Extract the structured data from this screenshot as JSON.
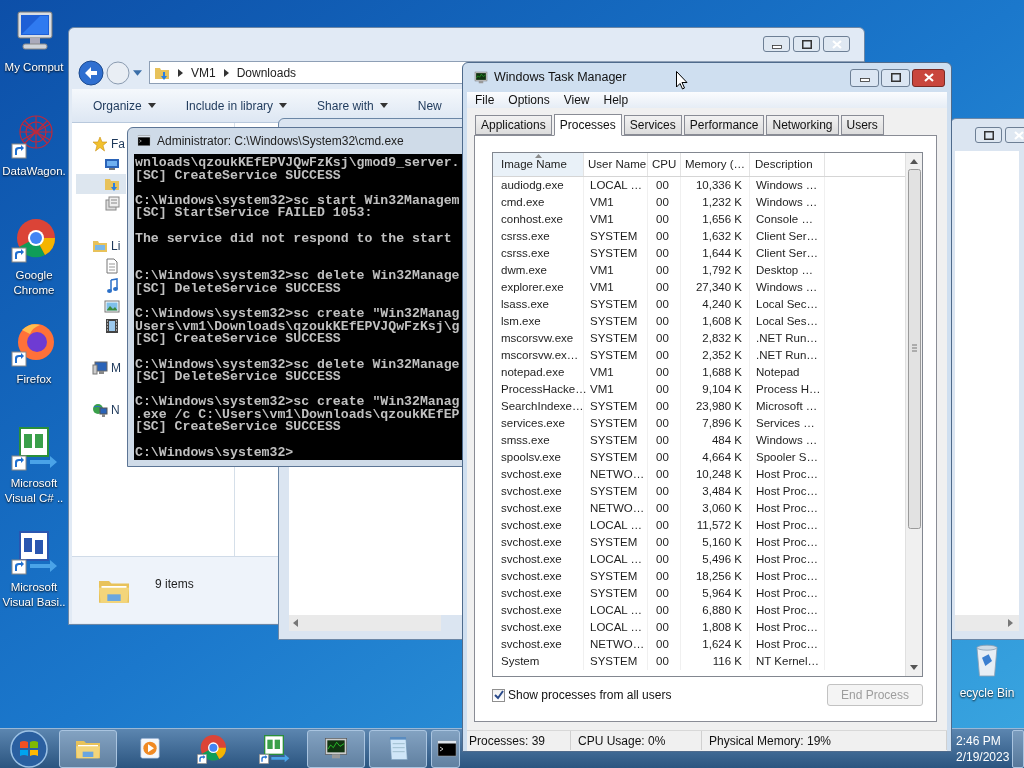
{
  "desktop_icons": [
    {
      "label": "My Comput",
      "kind": "computer"
    },
    {
      "label": "DataWagon.",
      "kind": "datawagon"
    },
    {
      "label": "Google Chrome",
      "kind": "chrome"
    },
    {
      "label": "Firefox",
      "kind": "firefox"
    },
    {
      "label": "Microsoft Visual C# ..",
      "kind": "csharp"
    },
    {
      "label": "Microsoft Visual Basi..",
      "kind": "vb"
    }
  ],
  "recycle_bin": {
    "label": "ecycle Bin"
  },
  "explorer": {
    "breadcrumb": [
      "VM1",
      "Downloads"
    ],
    "toolbar": [
      {
        "label": "Organize",
        "dropdown": true
      },
      {
        "label": "Include in library",
        "dropdown": true
      },
      {
        "label": "Share with",
        "dropdown": true
      },
      {
        "label": "New",
        "dropdown": false
      }
    ],
    "nav": [
      {
        "label": "Fa",
        "kind": "favorites",
        "selected": false,
        "children": [
          {
            "kind": "desktop",
            "selected": false
          },
          {
            "kind": "downloads",
            "selected": true
          },
          {
            "kind": "recent",
            "selected": false
          }
        ]
      },
      {
        "label": "Li",
        "kind": "libraries",
        "selected": false,
        "children": [
          {
            "kind": "documents",
            "selected": false
          },
          {
            "kind": "music",
            "selected": false
          },
          {
            "kind": "pictures",
            "selected": false
          },
          {
            "kind": "videos",
            "selected": false
          }
        ]
      },
      {
        "label": "M",
        "kind": "computer",
        "selected": false
      },
      {
        "label": "N",
        "kind": "network",
        "selected": false
      }
    ],
    "status": "9 items"
  },
  "cmd": {
    "title": "Administrator: C:\\Windows\\System32\\cmd.exe",
    "output": "wnloads\\qzoukKEfEPVJQwFzKsj\\gmod9_server.\n[SC] CreateService SUCCESS\n\nC:\\Windows\\system32>sc start Win32Managem\n[SC] StartService FAILED 1053:\n\nThe service did not respond to the start\n\n\nC:\\Windows\\system32>sc delete Win32Manage\n[SC] DeleteService SUCCESS\n\nC:\\Windows\\system32>sc create \"Win32Manag\nUsers\\vm1\\Downloads\\qzoukKEfEPVJQwFzKsj\\g\n[SC] CreateService SUCCESS\n\nC:\\Windows\\system32>sc delete Win32Manage\n[SC] DeleteService SUCCESS\n\nC:\\Windows\\system32>sc create \"Win32Manag\n.exe /c C:\\Users\\vm1\\Downloads\\qzoukKEfEP\n[SC] CreateService SUCCESS\n\nC:\\Windows\\system32>"
  },
  "task_manager": {
    "title": "Windows Task Manager",
    "menu": [
      "File",
      "Options",
      "View",
      "Help"
    ],
    "tabs": [
      {
        "label": "Applications",
        "selected": false
      },
      {
        "label": "Processes",
        "selected": true
      },
      {
        "label": "Services",
        "selected": false
      },
      {
        "label": "Performance",
        "selected": false
      },
      {
        "label": "Networking",
        "selected": false
      },
      {
        "label": "Users",
        "selected": false
      }
    ],
    "columns": [
      {
        "label": "Image Name",
        "sorted": true
      },
      {
        "label": "User Name",
        "sorted": false
      },
      {
        "label": "CPU",
        "sorted": false
      },
      {
        "label": "Memory (…",
        "sorted": false
      },
      {
        "label": "Description",
        "sorted": false
      }
    ],
    "rows": [
      [
        "audiodg.exe",
        "LOCAL …",
        "00",
        "10,336 K",
        "Windows …"
      ],
      [
        "cmd.exe",
        "VM1",
        "00",
        "1,232 K",
        "Windows …"
      ],
      [
        "conhost.exe",
        "VM1",
        "00",
        "1,656 K",
        "Console …"
      ],
      [
        "csrss.exe",
        "SYSTEM",
        "00",
        "1,632 K",
        "Client Ser…"
      ],
      [
        "csrss.exe",
        "SYSTEM",
        "00",
        "1,644 K",
        "Client Ser…"
      ],
      [
        "dwm.exe",
        "VM1",
        "00",
        "1,792 K",
        "Desktop …"
      ],
      [
        "explorer.exe",
        "VM1",
        "00",
        "27,340 K",
        "Windows …"
      ],
      [
        "lsass.exe",
        "SYSTEM",
        "00",
        "4,240 K",
        "Local Sec…"
      ],
      [
        "lsm.exe",
        "SYSTEM",
        "00",
        "1,608 K",
        "Local Ses…"
      ],
      [
        "mscorsvw.exe",
        "SYSTEM",
        "00",
        "2,832 K",
        ".NET Run…"
      ],
      [
        "mscorsvw.ex…",
        "SYSTEM",
        "00",
        "2,352 K",
        ".NET Run…"
      ],
      [
        "notepad.exe",
        "VM1",
        "00",
        "1,688 K",
        "Notepad"
      ],
      [
        "ProcessHacke…",
        "VM1",
        "00",
        "9,104 K",
        "Process H…"
      ],
      [
        "SearchIndexe…",
        "SYSTEM",
        "00",
        "23,980 K",
        "Microsoft …"
      ],
      [
        "services.exe",
        "SYSTEM",
        "00",
        "7,896 K",
        "Services …"
      ],
      [
        "smss.exe",
        "SYSTEM",
        "00",
        "484 K",
        "Windows …"
      ],
      [
        "spoolsv.exe",
        "SYSTEM",
        "00",
        "4,664 K",
        "Spooler S…"
      ],
      [
        "svchost.exe",
        "NETWO…",
        "00",
        "10,248 K",
        "Host Proc…"
      ],
      [
        "svchost.exe",
        "SYSTEM",
        "00",
        "3,484 K",
        "Host Proc…"
      ],
      [
        "svchost.exe",
        "NETWO…",
        "00",
        "3,060 K",
        "Host Proc…"
      ],
      [
        "svchost.exe",
        "LOCAL …",
        "00",
        "11,572 K",
        "Host Proc…"
      ],
      [
        "svchost.exe",
        "SYSTEM",
        "00",
        "5,160 K",
        "Host Proc…"
      ],
      [
        "svchost.exe",
        "LOCAL …",
        "00",
        "5,496 K",
        "Host Proc…"
      ],
      [
        "svchost.exe",
        "SYSTEM",
        "00",
        "18,256 K",
        "Host Proc…"
      ],
      [
        "svchost.exe",
        "SYSTEM",
        "00",
        "5,964 K",
        "Host Proc…"
      ],
      [
        "svchost.exe",
        "LOCAL …",
        "00",
        "6,880 K",
        "Host Proc…"
      ],
      [
        "svchost.exe",
        "LOCAL …",
        "00",
        "1,808 K",
        "Host Proc…"
      ],
      [
        "svchost.exe",
        "NETWO…",
        "00",
        "1,624 K",
        "Host Proc…"
      ],
      [
        "System",
        "SYSTEM",
        "00",
        "116 K",
        "NT Kernel…"
      ]
    ],
    "show_all_users": {
      "label": "Show processes from all users",
      "checked": true
    },
    "end_process": {
      "label": "End Process",
      "disabled": true
    },
    "status_bar": [
      "Processes: 39",
      "CPU Usage: 0%",
      "Physical Memory: 19%"
    ]
  },
  "taskbar": {
    "apps": [
      {
        "kind": "explorer",
        "running": true
      },
      {
        "kind": "media",
        "running": false
      },
      {
        "kind": "chrome",
        "running": false
      },
      {
        "kind": "csharp",
        "running": false
      },
      {
        "kind": "taskmgr",
        "running": true
      },
      {
        "kind": "notepad",
        "running": true
      },
      {
        "kind": "cmd",
        "running": true
      }
    ],
    "clock": {
      "time": "2:46 PM",
      "date": "2/19/2023"
    }
  }
}
